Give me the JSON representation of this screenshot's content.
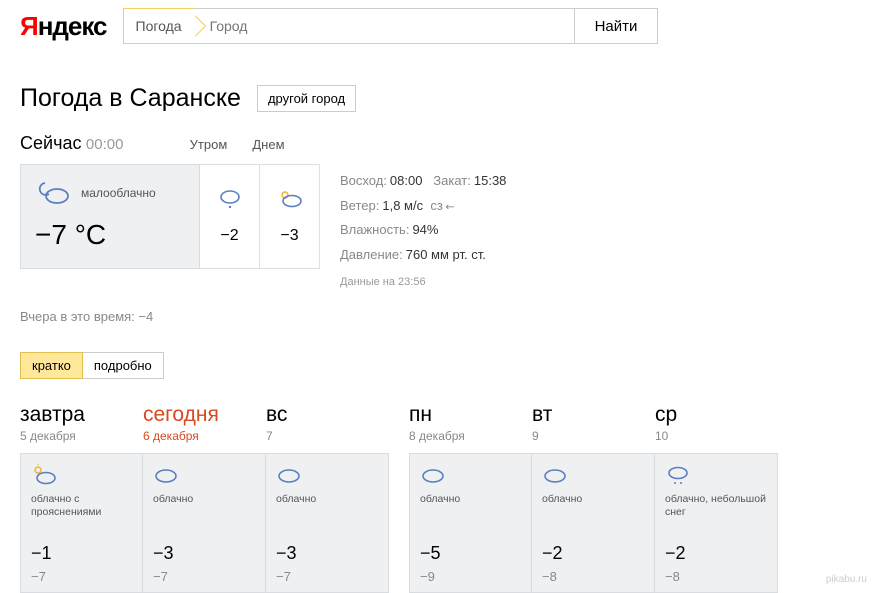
{
  "logo_main": "ндекс",
  "service_badge": "Погода",
  "search": {
    "placeholder": "Город",
    "button": "Найти"
  },
  "page_title": "Погода в Саранске",
  "other_city_btn": "другой город",
  "now": {
    "label": "Сейчас",
    "time": "00:00",
    "condition": "малооблачно",
    "temp": "−7 °C",
    "morning_label": "Утром",
    "day_label": "Днем",
    "morning_temp": "−2",
    "day_temp": "−3"
  },
  "details": {
    "sunrise_label": "Восход:",
    "sunrise": "08:00",
    "sunset_label": "Закат:",
    "sunset": "15:38",
    "wind_label": "Ветер:",
    "wind": "1,8 м/с",
    "wind_dir": "сз",
    "humidity_label": "Влажность:",
    "humidity": "94%",
    "pressure_label": "Давление:",
    "pressure": "760 мм рт. ст.",
    "stamp": "Данные на 23:56"
  },
  "yesterday": "Вчера в это время: −4",
  "tabs": {
    "brief": "кратко",
    "detail": "подробно"
  },
  "forecast_groups": [
    {
      "days": [
        {
          "title": "завтра",
          "date": "5 декабря",
          "cond": "облачно с прояснениями",
          "hi": "−1",
          "lo": "−7",
          "icon": "sun-cloud",
          "today": false
        },
        {
          "title": "сегодня",
          "date": "6 декабря",
          "cond": "облачно",
          "hi": "−3",
          "lo": "−7",
          "icon": "cloud",
          "today": true
        },
        {
          "title": "вс",
          "date": "7",
          "cond": "облачно",
          "hi": "−3",
          "lo": "−7",
          "icon": "cloud",
          "today": false
        }
      ]
    },
    {
      "days": [
        {
          "title": "пн",
          "date": "8 декабря",
          "cond": "облачно",
          "hi": "−5",
          "lo": "−9",
          "icon": "cloud",
          "today": false
        },
        {
          "title": "вт",
          "date": "9",
          "cond": "облачно",
          "hi": "−2",
          "lo": "−8",
          "icon": "cloud",
          "today": false
        },
        {
          "title": "ср",
          "date": "10",
          "cond": "облачно, небольшой снег",
          "hi": "−2",
          "lo": "−8",
          "icon": "cloud-snow",
          "today": false
        }
      ]
    }
  ],
  "watermark": "pikabu.ru"
}
